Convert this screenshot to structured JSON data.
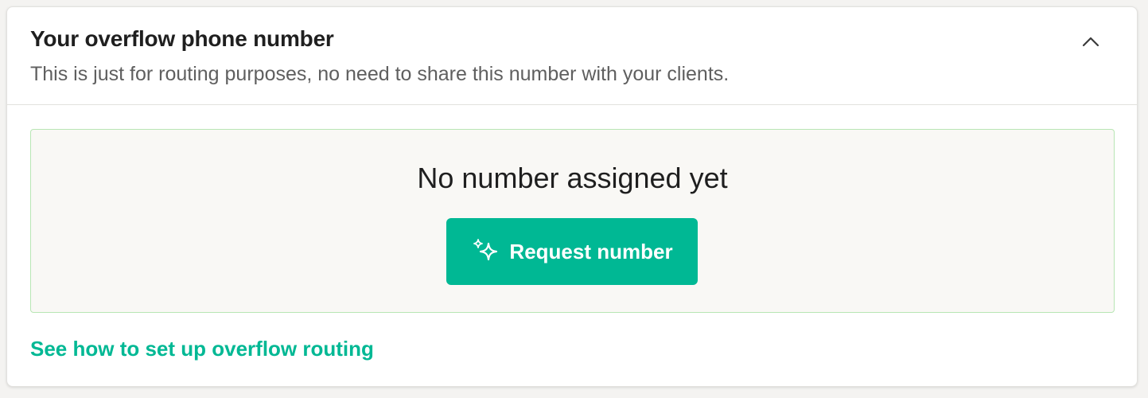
{
  "card": {
    "title": "Your overflow phone number",
    "subtitle": "This is just for routing purposes, no need to share this number with your clients.",
    "toggle_icon": "chevron-up-icon"
  },
  "empty_state": {
    "title": "No number assigned yet",
    "button_label": "Request number",
    "button_icon": "sparkle-icon"
  },
  "help_link": {
    "label": "See how to set up overflow routing"
  },
  "colors": {
    "accent": "#00b894",
    "empty_state_border": "#b8e6b4",
    "empty_state_background": "#f9f8f5"
  }
}
